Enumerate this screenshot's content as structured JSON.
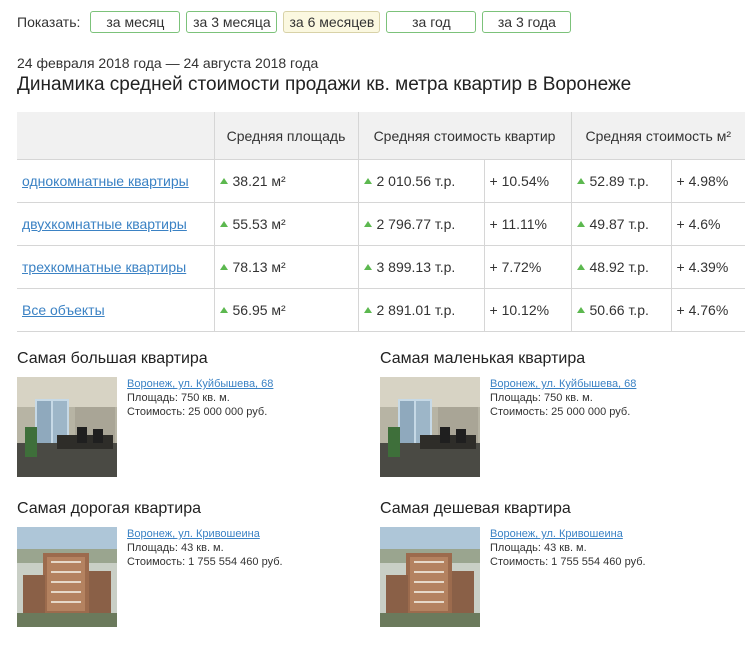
{
  "filters": {
    "label": "Показать:",
    "options": [
      "за месяц",
      "за 3 месяца",
      "за 6 месяцев",
      "за год",
      "за 3 года"
    ],
    "active_index": 2
  },
  "date_range": "24 февраля 2018 года — 24 августа 2018 года",
  "title": "Динамика средней стоимости продажи кв. метра квартир в Воронеже",
  "table": {
    "headers": {
      "area": "Средняя площадь",
      "price": "Средняя стоимость квартир",
      "sqm": "Средняя стоимость м²"
    },
    "rows": [
      {
        "name": "однокомнатные квартиры",
        "area": "38.21 м²",
        "price": "2 010.56 т.р.",
        "price_change": "+ 10.54%",
        "sqm": "52.89 т.р.",
        "sqm_change": "+ 4.98%"
      },
      {
        "name": "двухкомнатные квартиры",
        "area": "55.53 м²",
        "price": "2 796.77 т.р.",
        "price_change": "+ 11.11%",
        "sqm": "49.87 т.р.",
        "sqm_change": "+ 4.6%"
      },
      {
        "name": "трехкомнатные квартиры",
        "area": "78.13 м²",
        "price": "3 899.13 т.р.",
        "price_change": "+ 7.72%",
        "sqm": "48.92 т.р.",
        "sqm_change": "+ 4.39%"
      },
      {
        "name": "Все объекты",
        "area": "56.95 м²",
        "price": "2 891.01 т.р.",
        "price_change": "+ 10.12%",
        "sqm": "50.66 т.р.",
        "sqm_change": "+ 4.76%"
      }
    ]
  },
  "featured": {
    "largest": {
      "title": "Самая большая квартира",
      "address": "Воронеж, ул. Куйбышева, 68",
      "area": "Площадь: 750 кв. м.",
      "price": "Стоимость: 25 000 000 руб."
    },
    "smallest": {
      "title": "Самая маленькая квартира",
      "address": "Воронеж, ул. Куйбышева, 68",
      "area": "Площадь: 750 кв. м.",
      "price": "Стоимость: 25 000 000 руб."
    },
    "expensive": {
      "title": "Самая дорогая квартира",
      "address": "Воронеж, ул. Кривошеина",
      "area": "Площадь: 43 кв. м.",
      "price": "Стоимость: 1 755 554 460 руб."
    },
    "cheapest": {
      "title": "Самая дешевая квартира",
      "address": "Воронеж, ул. Кривошеина",
      "area": "Площадь: 43 кв. м.",
      "price": "Стоимость: 1 755 554 460 руб."
    }
  },
  "colors": {
    "accent_green": "#5cb84f",
    "link_blue": "#3b82c4",
    "active_filter_bg": "#fbf8e0"
  }
}
